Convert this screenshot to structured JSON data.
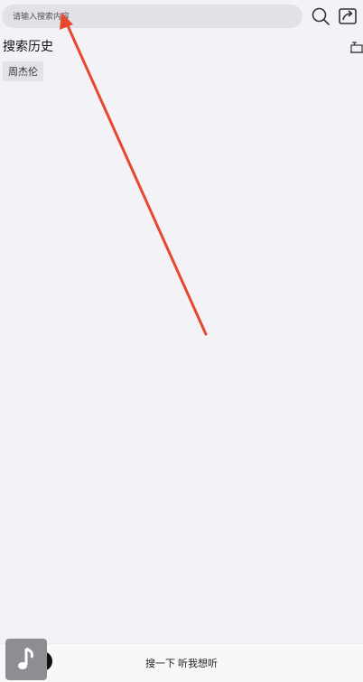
{
  "search": {
    "placeholder": "请输入搜索内容"
  },
  "history": {
    "title": "搜索历史",
    "items": [
      "周杰伦"
    ]
  },
  "player": {
    "text": "搜一下 听我想听"
  },
  "colors": {
    "annotation_arrow": "#e8472f",
    "background": "#f3f2f7",
    "search_bg": "#e2e1e6"
  },
  "icons": {
    "search": "search-icon",
    "share": "share-icon",
    "clear": "trash-icon",
    "cover": "music-note-icon"
  }
}
